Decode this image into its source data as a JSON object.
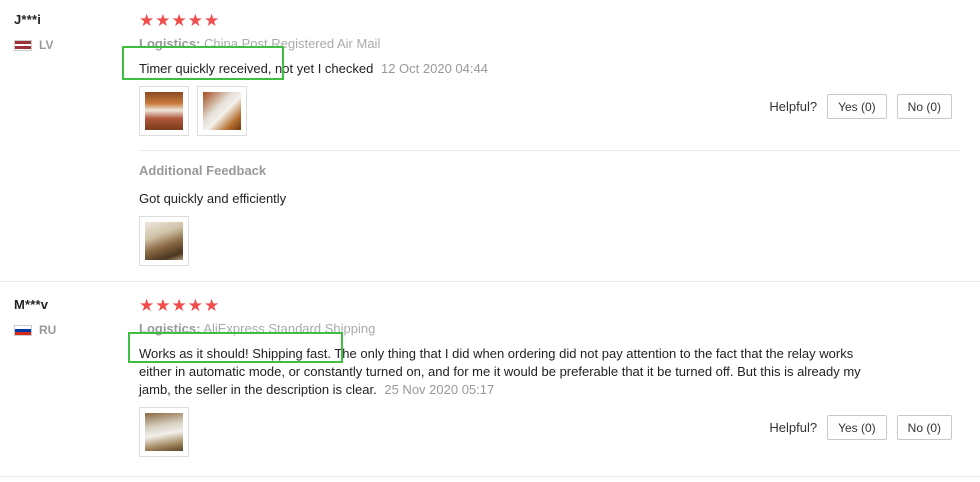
{
  "reviews": [
    {
      "username": "J***i",
      "country_code": "LV",
      "rating": "★★★★★",
      "logistics_label": "Logistics:",
      "logistics_value": "China Post Registered Air Mail",
      "comment": "Timer quickly received, not yet I checked",
      "date": "12 Oct 2020 04:44",
      "helpful_label": "Helpful?",
      "yes_label": "Yes (0)",
      "no_label": "No (0)",
      "additional_feedback_title": "Additional Feedback",
      "additional_feedback_text": "Got quickly and efficiently"
    },
    {
      "username": "M***v",
      "country_code": "RU",
      "rating": "★★★★★",
      "logistics_label": "Logistics:",
      "logistics_value": "AliExpress Standard Shipping",
      "comment": "Works as it should! Shipping fast. The only thing that I did when ordering did not pay attention to the fact that the relay works either in automatic mode, or constantly turned on, and for me it would be preferable that it be turned off. But this is already my jamb, the seller in the description is clear.",
      "date": "25 Nov 2020 05:17",
      "helpful_label": "Helpful?",
      "yes_label": "Yes (0)",
      "no_label": "No (0)"
    }
  ],
  "colors": {
    "stars": "#f04d4d",
    "highlight": "#3fbf3f",
    "muted": "#999999"
  }
}
